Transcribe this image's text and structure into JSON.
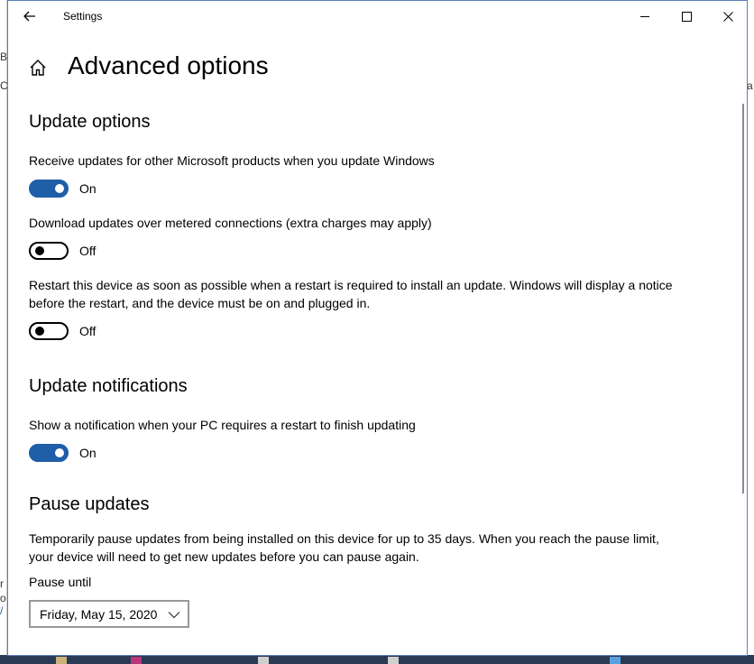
{
  "window": {
    "title": "Settings"
  },
  "page": {
    "title": "Advanced options"
  },
  "sections": {
    "update_options": {
      "title": "Update options",
      "receive_updates": {
        "label": "Receive updates for other Microsoft products when you update Windows",
        "state": "On",
        "on": true
      },
      "metered": {
        "label": "Download updates over metered connections (extra charges may apply)",
        "state": "Off",
        "on": false
      },
      "restart": {
        "label_line1": "Restart this device as soon as possible when a restart is required to install an update. Windows will display a notice",
        "label_line2": "before the restart, and the device must be on and plugged in.",
        "state": "Off",
        "on": false
      }
    },
    "update_notifications": {
      "title": "Update notifications",
      "restart_notification": {
        "label": "Show a notification when your PC requires a restart to finish updating",
        "state": "On",
        "on": true
      }
    },
    "pause_updates": {
      "title": "Pause updates",
      "description_line1": "Temporarily pause updates from being installed on this device for up to 35 days. When you reach the pause limit,",
      "description_line2": "your device will need to get new updates before you can pause again.",
      "pause_until_label": "Pause until",
      "pause_until_value": "Friday, May 15, 2020"
    }
  },
  "colors": {
    "accent": "#1f5ea8",
    "desktop": "#2b5797"
  }
}
